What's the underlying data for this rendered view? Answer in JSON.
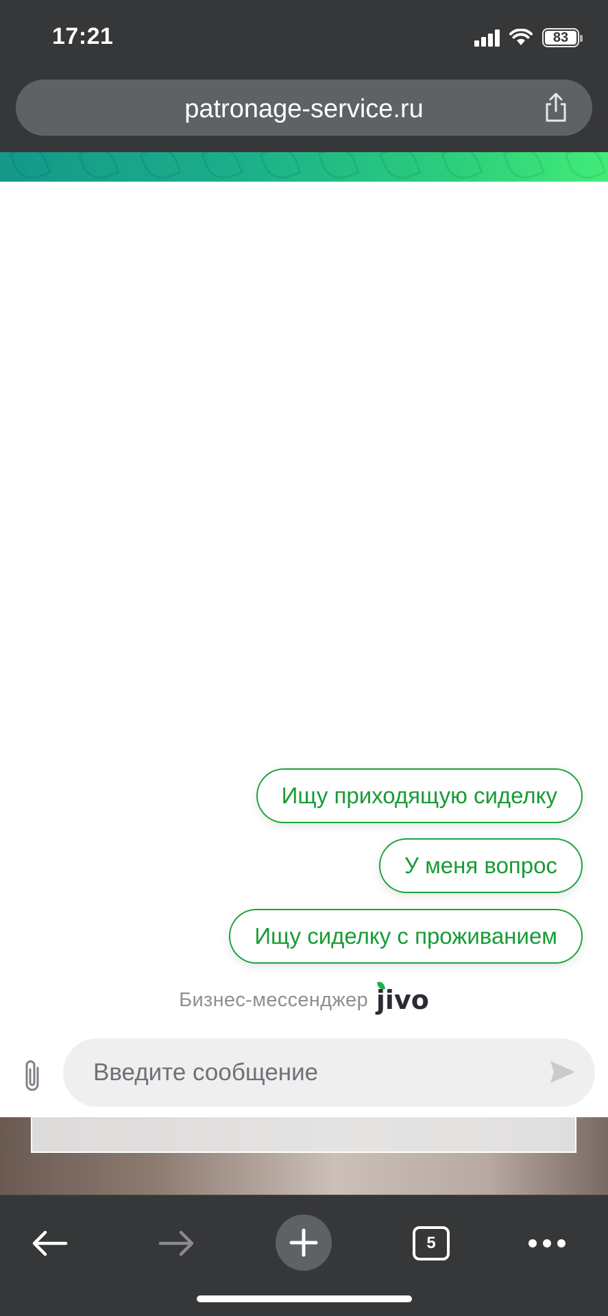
{
  "status_bar": {
    "time": "17:21",
    "battery_level": "83"
  },
  "browser": {
    "url": "patronage-service.ru",
    "tab_count": "5"
  },
  "chat": {
    "quick_replies": [
      "Ищу приходящую сиделку",
      "У меня вопрос",
      "Ищу сиделку с проживанием"
    ],
    "brand_label": "Бизнес-мессенджер",
    "brand_logo_text": "jivo",
    "input_placeholder": "Введите сообщение"
  },
  "colors": {
    "accent_green": "#1aa33a",
    "chrome_dark": "#363739",
    "address_bar": "#5f6264"
  },
  "icons": {
    "share": "share-icon",
    "attach": "paperclip-icon",
    "send": "send-icon",
    "back": "arrow-left-icon",
    "forward": "arrow-right-icon",
    "new_tab": "plus-icon",
    "tabs": "tabs-icon",
    "more": "more-icon"
  }
}
